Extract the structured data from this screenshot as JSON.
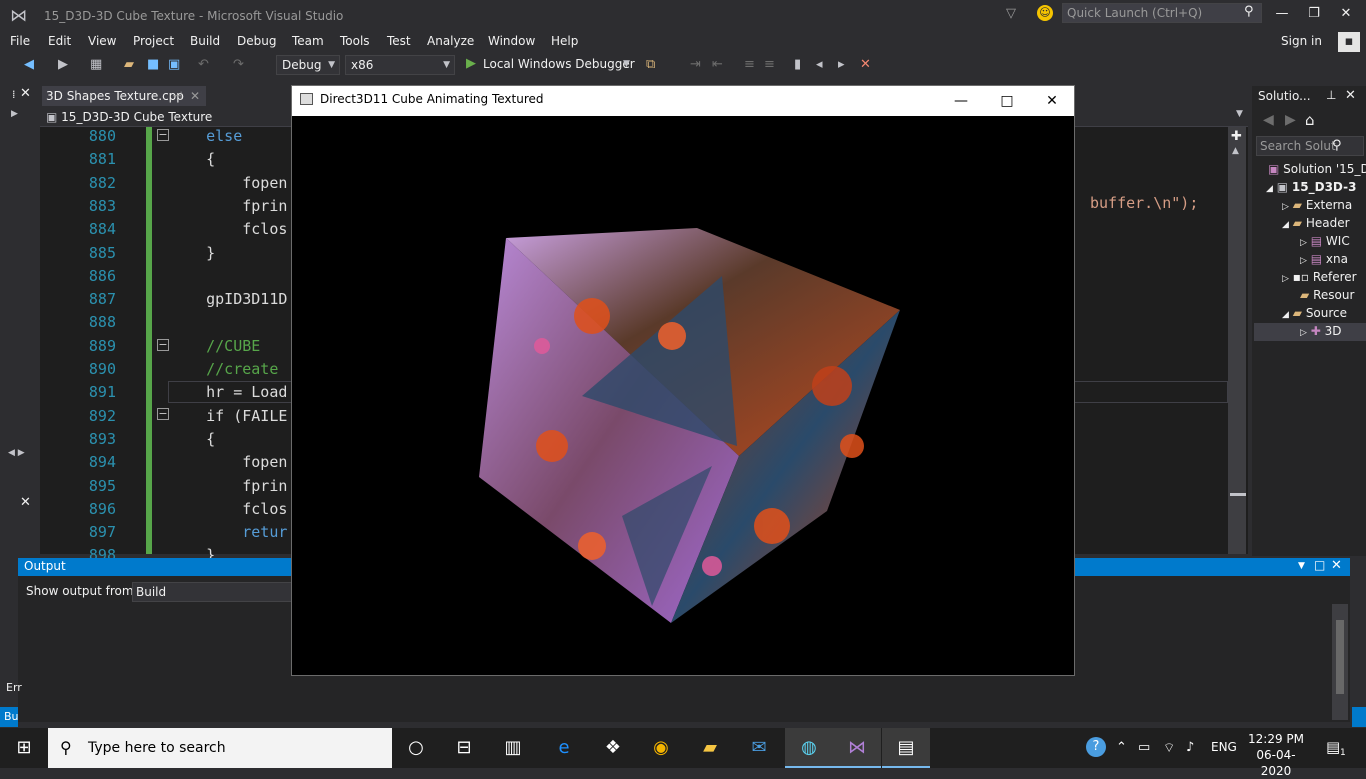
{
  "titlebar": {
    "title": "15_D3D-3D Cube Texture - Microsoft Visual Studio",
    "quick_launch_placeholder": "Quick Launch (Ctrl+Q)"
  },
  "menu": [
    "File",
    "Edit",
    "View",
    "Project",
    "Build",
    "Debug",
    "Team",
    "Tools",
    "Test",
    "Analyze",
    "Window",
    "Help"
  ],
  "signin": "Sign in",
  "toolbar": {
    "config": "Debug",
    "platform": "x86",
    "debugger": "Local Windows Debugger"
  },
  "editor": {
    "tab": "3D Shapes Texture.cpp",
    "project": "15_D3D-3D Cube Texture",
    "lines": [
      {
        "n": "880",
        "text": "    else",
        "color": "#569cd6"
      },
      {
        "n": "881",
        "text": "    {",
        "color": "#dcdcdc"
      },
      {
        "n": "882",
        "text": "        fopen",
        "color": "#dcdcdc"
      },
      {
        "n": "883",
        "text": "        fprin",
        "color": "#dcdcdc"
      },
      {
        "n": "884",
        "text": "        fclos",
        "color": "#dcdcdc"
      },
      {
        "n": "885",
        "text": "    }",
        "color": "#dcdcdc"
      },
      {
        "n": "886",
        "text": "",
        "color": "#dcdcdc"
      },
      {
        "n": "887",
        "text": "    gpID3D11D",
        "color": "#dcdcdc"
      },
      {
        "n": "888",
        "text": "",
        "color": "#dcdcdc"
      },
      {
        "n": "889",
        "text": "    //CUBE",
        "color": "#57a64a"
      },
      {
        "n": "890",
        "text": "    //create",
        "color": "#57a64a"
      },
      {
        "n": "891",
        "text": "    hr = Load",
        "color": "#dcdcdc"
      },
      {
        "n": "892",
        "text": "    if (FAILE",
        "color": "#dcdcdc"
      },
      {
        "n": "893",
        "text": "    {",
        "color": "#dcdcdc"
      },
      {
        "n": "894",
        "text": "        fopen",
        "color": "#dcdcdc"
      },
      {
        "n": "895",
        "text": "        fprin",
        "color": "#dcdcdc"
      },
      {
        "n": "896",
        "text": "        fclos",
        "color": "#dcdcdc"
      },
      {
        "n": "897",
        "text": "        retur",
        "color": "#569cd6"
      },
      {
        "n": "898",
        "text": "    }",
        "color": "#dcdcdc"
      }
    ],
    "line_883_tail": "buffer.\\n\");"
  },
  "solution": {
    "title": "Solutio...",
    "search_placeholder": "Search Solut",
    "items": [
      {
        "label": "Solution '15_D"
      },
      {
        "label": "15_D3D-3"
      },
      {
        "label": "Externa"
      },
      {
        "label": "Header"
      },
      {
        "label": "WIC"
      },
      {
        "label": "xna"
      },
      {
        "label": "Referer"
      },
      {
        "label": "Resour"
      },
      {
        "label": "Source"
      },
      {
        "label": "3D"
      }
    ]
  },
  "output": {
    "title": "Output",
    "show_from_label": "Show output from:",
    "show_from_value": "Build",
    "status_short": "Bu",
    "side_label": "Err"
  },
  "dx_window": {
    "title": "Direct3D11 Cube Animating Textured"
  },
  "taskbar": {
    "search_placeholder": "Type here to search",
    "language": "ENG",
    "time": "12:29 PM",
    "date": "06-04-2020",
    "notification_count": "1"
  },
  "colors": {
    "accent": "#007acc",
    "background": "#2d2d30",
    "editor_bg": "#1e1e1e"
  }
}
